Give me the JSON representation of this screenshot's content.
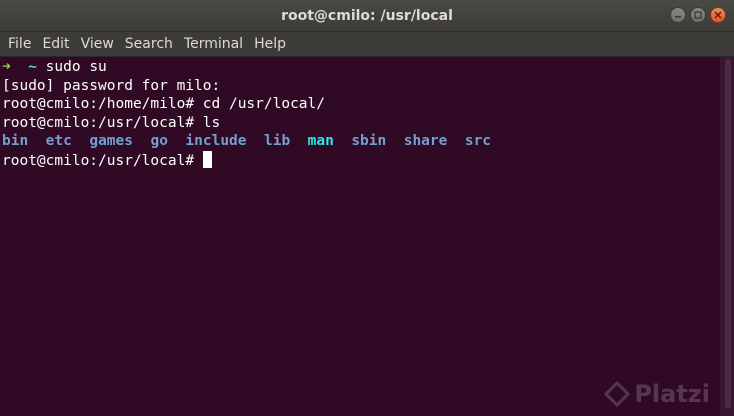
{
  "window": {
    "title": "root@cmilo: /usr/local"
  },
  "menu": {
    "items": [
      "File",
      "Edit",
      "View",
      "Search",
      "Terminal",
      "Help"
    ]
  },
  "terminal": {
    "line1": {
      "arrow": "➜",
      "tilde": "~",
      "command": "sudo su"
    },
    "line2": "[sudo] password for milo:",
    "line3": "root@cmilo:/home/milo# cd /usr/local/",
    "line4": "root@cmilo:/usr/local# ls",
    "ls_entries": [
      "bin",
      "etc",
      "games",
      "go",
      "include",
      "lib",
      "man",
      "sbin",
      "share",
      "src"
    ],
    "prompt": "root@cmilo:/usr/local# "
  },
  "watermark": {
    "text": "Platzi"
  },
  "colors": {
    "background": "#300a24",
    "directory": "#729fcf",
    "link_directory": "#34e2e2",
    "arrow": "#8ae234"
  }
}
